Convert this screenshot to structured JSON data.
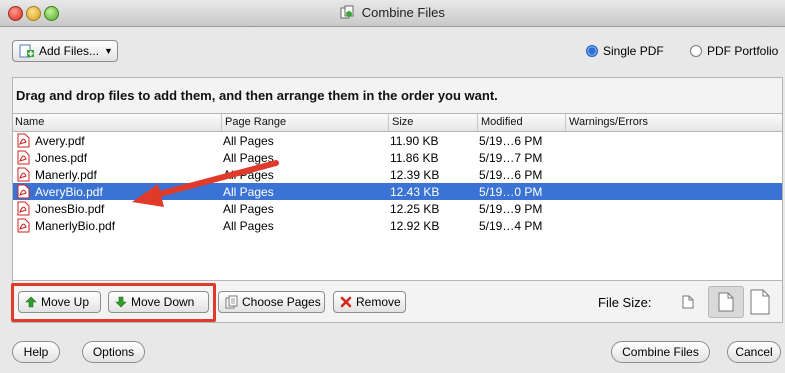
{
  "window": {
    "title": "Combine Files"
  },
  "toolbar": {
    "add_files": "Add Files...",
    "radio_single": "Single PDF",
    "radio_portfolio": "PDF Portfolio",
    "selected_output": "Single PDF"
  },
  "instructions": "Drag and drop files to add them, and then arrange them in the order you want.",
  "table": {
    "columns": [
      "Name",
      "Page Range",
      "Size",
      "Modified",
      "Warnings/Errors"
    ],
    "rows": [
      {
        "name": "Avery.pdf",
        "range": "All Pages",
        "size": "11.90 KB",
        "modified": "5/19…6 PM",
        "warnings": ""
      },
      {
        "name": "Jones.pdf",
        "range": "All Pages",
        "size": "11.86 KB",
        "modified": "5/19…7 PM",
        "warnings": ""
      },
      {
        "name": "Manerly.pdf",
        "range": "All Pages",
        "size": "12.39 KB",
        "modified": "5/19…6 PM",
        "warnings": ""
      },
      {
        "name": "AveryBio.pdf",
        "range": "All Pages",
        "size": "12.43 KB",
        "modified": "5/19…0 PM",
        "warnings": ""
      },
      {
        "name": "JonesBio.pdf",
        "range": "All Pages",
        "size": "12.25 KB",
        "modified": "5/19…9 PM",
        "warnings": ""
      },
      {
        "name": "ManerlyBio.pdf",
        "range": "All Pages",
        "size": "12.92 KB",
        "modified": "5/19…4 PM",
        "warnings": ""
      }
    ],
    "selected_row": "AveryBio.pdf"
  },
  "actions": {
    "move_up": "Move Up",
    "move_down": "Move Down",
    "choose_pages": "Choose Pages",
    "remove": "Remove",
    "file_size_label": "File Size:"
  },
  "footer": {
    "help": "Help",
    "options": "Options",
    "combine": "Combine Files",
    "cancel": "Cancel"
  },
  "colors": {
    "selection": "#3b73d4",
    "annotation_red": "#e03a2a",
    "arrow_green": "#2e9d2e"
  },
  "icons": [
    "pdf-file-icon",
    "add-files-icon",
    "arrow-up-icon",
    "arrow-down-icon",
    "pages-icon",
    "remove-x-icon",
    "file-size-icon"
  ]
}
